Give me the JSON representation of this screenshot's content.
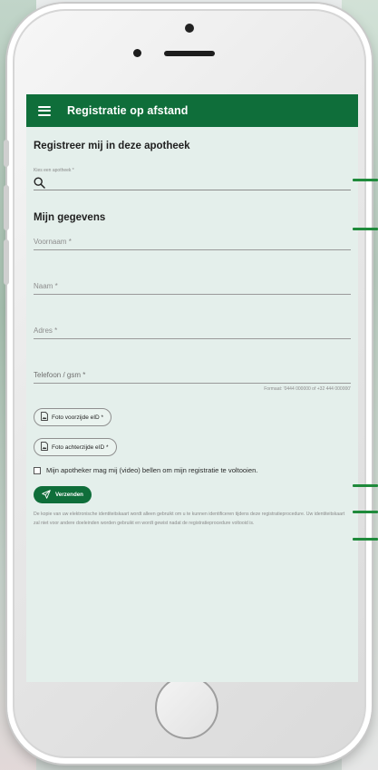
{
  "app_bar": {
    "title": "Registratie op afstand",
    "menu_icon": "hamburger-menu-icon"
  },
  "form": {
    "section_pharmacy_title": "Registreer mij in deze apotheek",
    "pharmacy_label": "Kies een apotheek *",
    "pharmacy_value": "",
    "search_icon": "search-icon",
    "section_personal_title": "Mijn gegevens",
    "fields": {
      "voornaam": "Voornaam *",
      "naam": "Naam *",
      "adres": "Adres *",
      "telefoon": "Telefoon / gsm *"
    },
    "phone_hint": "Formaat: '0444 000000 of +32 444 000000'",
    "photo_front_label": "Foto voorzijde eID *",
    "photo_back_label": "Foto achterzijde eID *",
    "callback_checkbox_label": "Mijn apotheker mag mij (video) bellen om mijn registratie te voltooien.",
    "callback_checked": false,
    "submit_label": "Verzenden",
    "disclaimer": "De kopie van uw elektronische identiteitskaart wordt alleen gebruikt om u te kunnen identificeren tijdens deze registratieprocedure. Uw identiteitskaart zal niet voor andere doeleinden worden gebruikt en wordt gewist nadat de registratieprocedure voltooid is."
  },
  "colors": {
    "brand_green": "#0f6e3a",
    "screen_background": "#e4efeb",
    "marker_green": "#1f8a3b"
  }
}
